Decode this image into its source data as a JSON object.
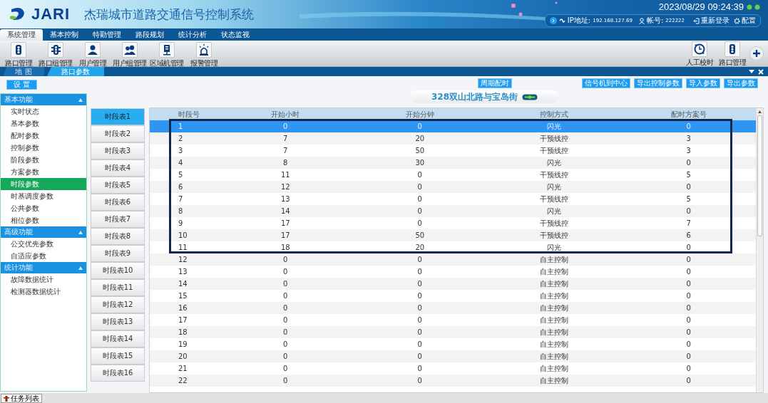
{
  "header": {
    "logo": "JARI",
    "title": "杰瑞城市道路交通信号控制系统",
    "datetime": "2023/08/29 09:24:39",
    "info": {
      "ip_label": "IP地址:",
      "ip": "192.168.127.69",
      "account_label": "帐号:",
      "account": "222222",
      "relogin": "重新登录",
      "config": "配置"
    }
  },
  "menu": [
    {
      "label": "系统管理",
      "selected": true
    },
    {
      "label": "基本控制",
      "selected": false
    },
    {
      "label": "特勤管理",
      "selected": false
    },
    {
      "label": "路段规划",
      "selected": false
    },
    {
      "label": "统计分析",
      "selected": false
    },
    {
      "label": "状态监视",
      "selected": false
    }
  ],
  "toolbar": [
    {
      "label": "路口管理",
      "kind": "signal"
    },
    {
      "label": "路口组管理",
      "kind": "signals"
    },
    {
      "label": "用户管理",
      "kind": "user"
    },
    {
      "label": "用户组管理",
      "kind": "users"
    },
    {
      "label": "区域机管理",
      "kind": "server"
    },
    {
      "label": "报警管理",
      "kind": "alarm"
    }
  ],
  "toolbar_right": [
    {
      "label": "人工校时",
      "kind": "clock"
    },
    {
      "label": "路口管理",
      "kind": "signal"
    }
  ],
  "view_tabs": [
    {
      "label": "地 图",
      "selected": false
    },
    {
      "label": "路口参数",
      "selected": true
    }
  ],
  "settings_button": "设 置",
  "sidebar": [
    {
      "title": "基本功能",
      "expanded": true,
      "items": [
        {
          "label": "实时状态",
          "selected": false
        },
        {
          "label": "基本参数",
          "selected": false
        },
        {
          "label": "配时参数",
          "selected": false
        },
        {
          "label": "控制参数",
          "selected": false
        },
        {
          "label": "阶段参数",
          "selected": false
        },
        {
          "label": "方案参数",
          "selected": false
        },
        {
          "label": "时段参数",
          "selected": true
        },
        {
          "label": "时基调度参数",
          "selected": false
        },
        {
          "label": "公共参数",
          "selected": false
        },
        {
          "label": "相位参数",
          "selected": false
        }
      ]
    },
    {
      "title": "高级功能",
      "expanded": true,
      "items": [
        {
          "label": "公交优先参数",
          "selected": false
        },
        {
          "label": "自适应参数",
          "selected": false
        }
      ]
    },
    {
      "title": "统计功能",
      "expanded": true,
      "items": [
        {
          "label": "故障数据统计",
          "selected": false
        },
        {
          "label": "检测器数据统计",
          "selected": false
        }
      ]
    }
  ],
  "actions_left": [
    "周期配时"
  ],
  "actions_right": [
    "信号机到中心",
    "导出控制参数",
    "导入参数",
    "导出参数"
  ],
  "intersection": {
    "name": "328双山北路与宝岛街"
  },
  "schedules": [
    {
      "label": "时段表1",
      "selected": true
    },
    {
      "label": "时段表2",
      "selected": false
    },
    {
      "label": "时段表3",
      "selected": false
    },
    {
      "label": "时段表4",
      "selected": false
    },
    {
      "label": "时段表5",
      "selected": false
    },
    {
      "label": "时段表6",
      "selected": false
    },
    {
      "label": "时段表7",
      "selected": false
    },
    {
      "label": "时段表8",
      "selected": false
    },
    {
      "label": "时段表9",
      "selected": false
    },
    {
      "label": "时段表10",
      "selected": false
    },
    {
      "label": "时段表11",
      "selected": false
    },
    {
      "label": "时段表12",
      "selected": false
    },
    {
      "label": "时段表13",
      "selected": false
    },
    {
      "label": "时段表14",
      "selected": false
    },
    {
      "label": "时段表15",
      "selected": false
    },
    {
      "label": "时段表16",
      "selected": false
    }
  ],
  "table": {
    "columns": [
      "时段号",
      "开始小时",
      "开始分钟",
      "控制方式",
      "配时方案号"
    ],
    "rows": [
      {
        "cells": [
          "1",
          "0",
          "0",
          "闪光",
          "0"
        ],
        "selected": true
      },
      {
        "cells": [
          "2",
          "7",
          "20",
          "干预线控",
          "3"
        ],
        "selected": false
      },
      {
        "cells": [
          "3",
          "7",
          "50",
          "干预线控",
          "3"
        ],
        "selected": false
      },
      {
        "cells": [
          "4",
          "8",
          "30",
          "闪光",
          "0"
        ],
        "selected": false
      },
      {
        "cells": [
          "5",
          "11",
          "0",
          "干预线控",
          "5"
        ],
        "selected": false
      },
      {
        "cells": [
          "6",
          "12",
          "0",
          "闪光",
          "0"
        ],
        "selected": false
      },
      {
        "cells": [
          "7",
          "13",
          "0",
          "干预线控",
          "5"
        ],
        "selected": false
      },
      {
        "cells": [
          "8",
          "14",
          "0",
          "闪光",
          "0"
        ],
        "selected": false
      },
      {
        "cells": [
          "9",
          "17",
          "0",
          "干预线控",
          "7"
        ],
        "selected": false
      },
      {
        "cells": [
          "10",
          "17",
          "50",
          "干预线控",
          "6"
        ],
        "selected": false
      },
      {
        "cells": [
          "11",
          "18",
          "20",
          "闪光",
          "0"
        ],
        "selected": false
      },
      {
        "cells": [
          "12",
          "0",
          "0",
          "自主控制",
          "0"
        ],
        "selected": false
      },
      {
        "cells": [
          "13",
          "0",
          "0",
          "自主控制",
          "0"
        ],
        "selected": false
      },
      {
        "cells": [
          "14",
          "0",
          "0",
          "自主控制",
          "0"
        ],
        "selected": false
      },
      {
        "cells": [
          "15",
          "0",
          "0",
          "自主控制",
          "0"
        ],
        "selected": false
      },
      {
        "cells": [
          "16",
          "0",
          "0",
          "自主控制",
          "0"
        ],
        "selected": false
      },
      {
        "cells": [
          "17",
          "0",
          "0",
          "自主控制",
          "0"
        ],
        "selected": false
      },
      {
        "cells": [
          "18",
          "0",
          "0",
          "自主控制",
          "0"
        ],
        "selected": false
      },
      {
        "cells": [
          "19",
          "0",
          "0",
          "自主控制",
          "0"
        ],
        "selected": false
      },
      {
        "cells": [
          "20",
          "0",
          "0",
          "自主控制",
          "0"
        ],
        "selected": false
      },
      {
        "cells": [
          "21",
          "0",
          "0",
          "自主控制",
          "0"
        ],
        "selected": false
      },
      {
        "cells": [
          "22",
          "0",
          "0",
          "自主控制",
          "0"
        ],
        "selected": false
      }
    ]
  },
  "taskbar": {
    "label": "任务列表"
  }
}
